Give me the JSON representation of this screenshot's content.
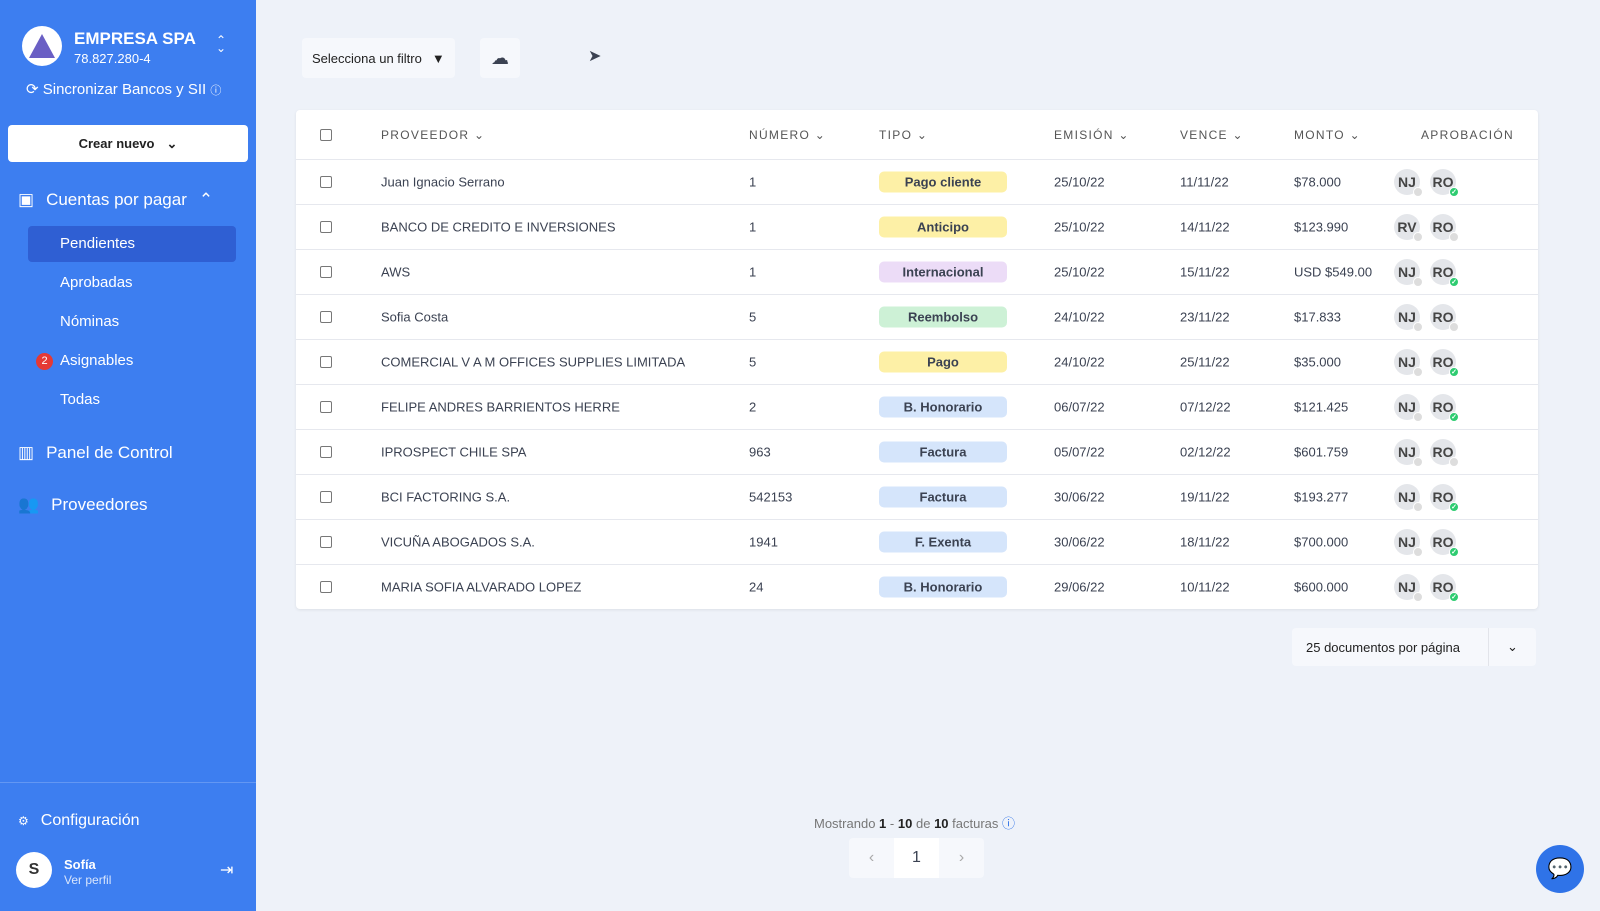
{
  "company": {
    "name": "EMPRESA SPA",
    "rut": "78.827.280-4",
    "sync": "Sincronizar Bancos y SII"
  },
  "create_label": "Crear nuevo",
  "nav": {
    "payables": "Cuentas por pagar",
    "sub": [
      {
        "label": "Pendientes"
      },
      {
        "label": "Aprobadas"
      },
      {
        "label": "Nóminas"
      },
      {
        "label": "Asignables",
        "badge": "2"
      },
      {
        "label": "Todas"
      }
    ],
    "dashboard": "Panel de Control",
    "providers": "Proveedores",
    "settings": "Configuración"
  },
  "user": {
    "initial": "S",
    "name": "Sofía",
    "profile": "Ver perfil"
  },
  "toolbar": {
    "filter": "Selecciona un filtro"
  },
  "columns": [
    "PROVEEDOR",
    "NÚMERO",
    "TIPO",
    "EMISIÓN",
    "VENCE",
    "MONTO",
    "APROBACIÓN"
  ],
  "tag_colors": {
    "Pago cliente": "#fdf0a6",
    "Anticipo": "#fdf0a6",
    "Pago": "#fdf0a6",
    "Internacional": "#ecdcf7",
    "Reembolso": "#cdf1d6",
    "B. Honorario": "#d5e5fb",
    "Factura": "#d5e5fb",
    "F. Exenta": "#d5e5fb"
  },
  "rows": [
    {
      "provider": "Juan Ignacio Serrano",
      "number": "1",
      "type": "Pago cliente",
      "issued": "25/10/22",
      "due": "11/11/22",
      "amount": "$78.000",
      "a1": "NJ",
      "a2": "RO",
      "ok": true
    },
    {
      "provider": "BANCO DE CREDITO E INVERSIONES",
      "number": "1",
      "type": "Anticipo",
      "issued": "25/10/22",
      "due": "14/11/22",
      "amount": "$123.990",
      "a1": "RV",
      "a2": "RO",
      "ok": false
    },
    {
      "provider": "AWS",
      "number": "1",
      "type": "Internacional",
      "issued": "25/10/22",
      "due": "15/11/22",
      "amount": "USD $549.00",
      "a1": "NJ",
      "a2": "RO",
      "ok": true
    },
    {
      "provider": "Sofia Costa",
      "number": "5",
      "type": "Reembolso",
      "issued": "24/10/22",
      "due": "23/11/22",
      "amount": "$17.833",
      "a1": "NJ",
      "a2": "RO",
      "ok": false
    },
    {
      "provider": "COMERCIAL V A M OFFICES SUPPLIES LIMITADA",
      "number": "5",
      "type": "Pago",
      "issued": "24/10/22",
      "due": "25/11/22",
      "amount": "$35.000",
      "a1": "NJ",
      "a2": "RO",
      "ok": true
    },
    {
      "provider": "FELIPE ANDRES BARRIENTOS HERRE",
      "number": "2",
      "type": "B. Honorario",
      "issued": "06/07/22",
      "due": "07/12/22",
      "amount": "$121.425",
      "a1": "NJ",
      "a2": "RO",
      "ok": true
    },
    {
      "provider": "IPROSPECT CHILE SPA",
      "number": "963",
      "type": "Factura",
      "issued": "05/07/22",
      "due": "02/12/22",
      "amount": "$601.759",
      "a1": "NJ",
      "a2": "RO",
      "ok": false
    },
    {
      "provider": "BCI FACTORING S.A.",
      "number": "542153",
      "type": "Factura",
      "issued": "30/06/22",
      "due": "19/11/22",
      "amount": "$193.277",
      "a1": "NJ",
      "a2": "RO",
      "ok": true
    },
    {
      "provider": "VICUÑA ABOGADOS S.A.",
      "number": "1941",
      "type": "F. Exenta",
      "issued": "30/06/22",
      "due": "18/11/22",
      "amount": "$700.000",
      "a1": "NJ",
      "a2": "RO",
      "ok": true
    },
    {
      "provider": "MARIA SOFIA ALVARADO LOPEZ",
      "number": "24",
      "type": "B. Honorario",
      "issued": "29/06/22",
      "due": "10/11/22",
      "amount": "$600.000",
      "a1": "NJ",
      "a2": "RO",
      "ok": true
    }
  ],
  "per_page": "25 documentos por página",
  "pagination": {
    "prefix": "Mostrando",
    "from": "1",
    "sep": "-",
    "to": "10",
    "of": "de",
    "total": "10",
    "suffix": "facturas",
    "page": "1"
  }
}
